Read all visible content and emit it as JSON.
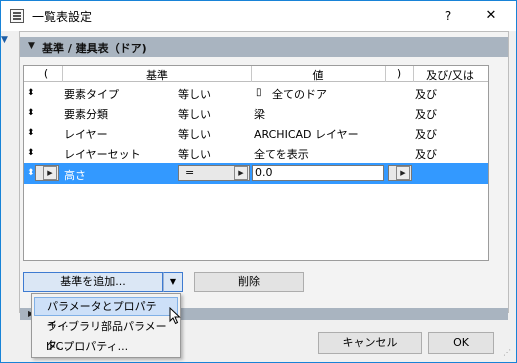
{
  "window": {
    "title": "一覧表設定",
    "help": "?",
    "close": "✕"
  },
  "panel": {
    "title": "基準 / 建具表（ドア)"
  },
  "table": {
    "headers": {
      "open_paren": "(",
      "criteria": "基準",
      "value": "値",
      "close_paren": ")",
      "and_or": "及び/又は"
    },
    "rows": [
      {
        "name": "要素タイプ",
        "op": "等しい",
        "value": "全てのドア",
        "conj": "及び"
      },
      {
        "name": "要素分類",
        "op": "等しい",
        "value": "梁",
        "conj": "及び"
      },
      {
        "name": "レイヤー",
        "op": "等しい",
        "value": "ARCHICAD レイヤー",
        "conj": "及び"
      },
      {
        "name": "レイヤーセット",
        "op": "等しい",
        "value": "全てを表示",
        "conj": "及び"
      }
    ],
    "selected_row": {
      "name": "高さ",
      "op": "=",
      "value": "0.0",
      "conj": ""
    }
  },
  "buttons": {
    "add": "基準を追加...",
    "delete": "削除",
    "cancel": "キャンセル",
    "ok": "OK"
  },
  "menu": {
    "items": [
      "パラメータとプロパティ...",
      "ライブラリ部品パラメータ...",
      "IFCプロパティ..."
    ]
  },
  "colors": {
    "selection": "#3399ff",
    "panel_header": "#a9b4c0",
    "button_focus": "#3e7bd1"
  }
}
